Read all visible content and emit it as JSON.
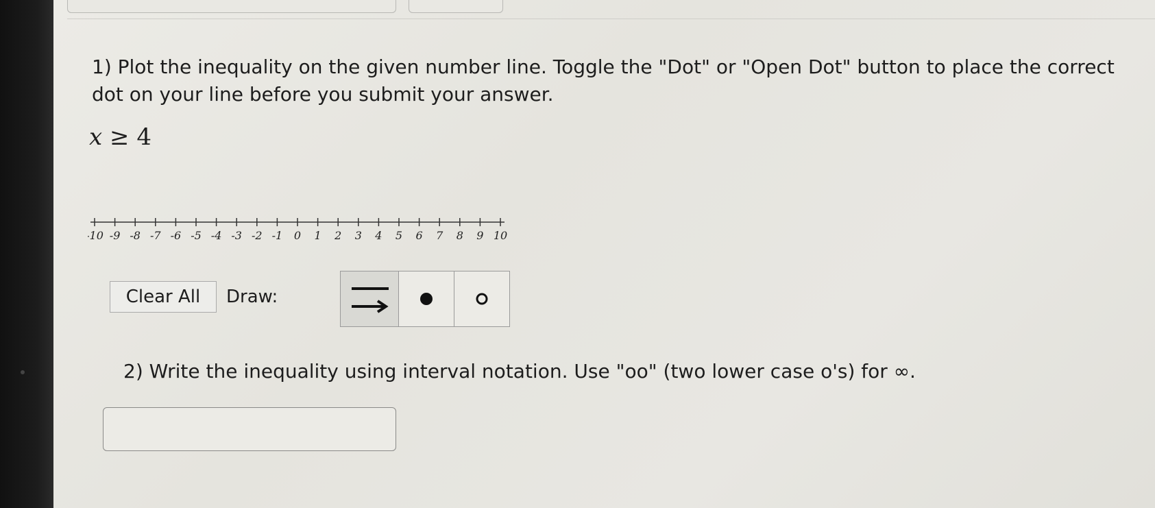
{
  "question1": {
    "text": "1) Plot the inequality on the given number line. Toggle the \"Dot\" or \"Open Dot\" button to place the correct dot on your line before you submit your answer."
  },
  "inequality": {
    "variable": "x",
    "operator": "≥",
    "value": "4"
  },
  "number_line": {
    "min": -10,
    "max": 10,
    "ticks": [
      "-10",
      "-9",
      "-8",
      "-7",
      "-6",
      "-5",
      "-4",
      "-3",
      "-2",
      "-1",
      "0",
      "1",
      "2",
      "3",
      "4",
      "5",
      "6",
      "7",
      "8",
      "9",
      "10"
    ]
  },
  "controls": {
    "clear_label": "Clear All",
    "draw_label": "Draw:",
    "tools": [
      {
        "name": "ray",
        "icon": "ray-arrow-icon",
        "selected": true
      },
      {
        "name": "dot",
        "icon": "filled-dot-icon",
        "selected": false
      },
      {
        "name": "open-dot",
        "icon": "open-dot-icon",
        "selected": false
      }
    ]
  },
  "question2": {
    "text": "2) Write the inequality using interval notation. Use \"oo\" (two lower case o's) for ∞."
  },
  "answer_input": {
    "value": "",
    "placeholder": ""
  }
}
